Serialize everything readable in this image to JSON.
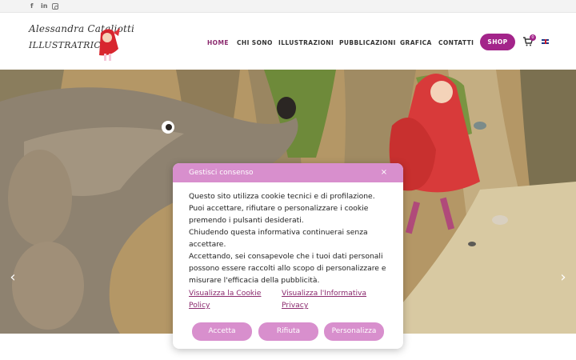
{
  "social": {
    "facebook": "f",
    "linkedin": "in",
    "instagram_icon": "instagram-icon"
  },
  "logo": {
    "line1": "Alessandra Cataliotti",
    "line2": "ILLUSTRATRICE"
  },
  "nav": {
    "items": [
      {
        "label": "HOME",
        "active": true
      },
      {
        "label": "CHI SONO",
        "active": false
      },
      {
        "label": "ILLUSTRAZIONI",
        "active": false
      },
      {
        "label": "PUBBLICAZIONI",
        "active": false
      },
      {
        "label": "GRAFICA",
        "active": false
      },
      {
        "label": "CONTATTI",
        "active": false
      }
    ],
    "shop_label": "SHOP",
    "cart_count": "0"
  },
  "hero": {
    "prev_arrow": "‹",
    "next_arrow": "›"
  },
  "consent": {
    "title": "Gestisci consenso",
    "close": "×",
    "paragraphs": [
      "Questo sito utilizza cookie tecnici e di profilazione. Puoi accettare, rifiutare o personalizzare i cookie premendo i pulsanti desiderati.",
      "Chiudendo questa informativa continuerai senza accettare.",
      "Accettando, sei consapevole che i tuoi dati personali possono essere raccolti allo scopo di personalizzare e misurare l'efficacia della pubblicità."
    ],
    "links": {
      "cookie_policy": "Visualizza la Cookie Policy",
      "privacy": "Visualizza l'Informativa Privacy"
    },
    "buttons": {
      "accept": "Accetta",
      "reject": "Rifiuta",
      "customize": "Personalizza"
    }
  },
  "colors": {
    "accent": "#a3248a",
    "dialog_accent": "#d88fcd",
    "active_nav": "#8b2a6e"
  }
}
